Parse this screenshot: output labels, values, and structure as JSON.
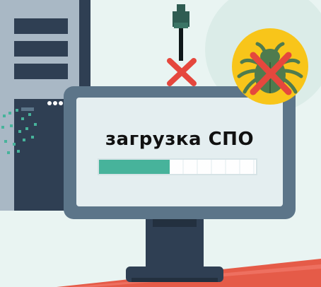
{
  "screen": {
    "title": "загрузка СПО",
    "progress": 0.45
  },
  "icons": {
    "usb": "usb-stick-icon",
    "blocked_mark": "cross-icon",
    "bug": "bug-icon"
  },
  "colors": {
    "background": "#e9f4f2",
    "floor": "#e55b48",
    "floor_shadow": "#c84a3b",
    "monitor_frame": "#5c7589",
    "monitor_screen": "#e4eef0",
    "monitor_stand": "#2f3f53",
    "tower_body": "#a9b8c5",
    "tower_panel": "#2f3f53",
    "progress_fill": "#47b39b",
    "progress_track": "#f6fafb",
    "cross": "#e5473d",
    "badge": "#f8c51a",
    "bug_body": "#4f7b4e",
    "usb_connector": "#2f5c52"
  }
}
